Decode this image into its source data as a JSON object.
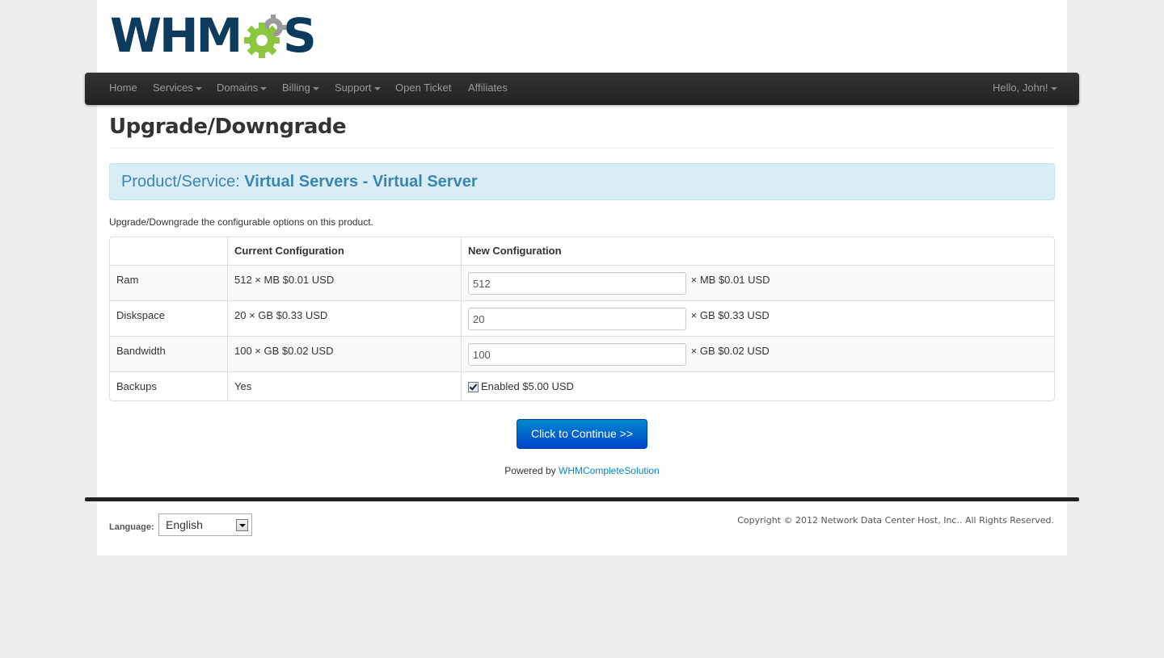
{
  "logo": {
    "text_left": "WHM",
    "text_right": "S",
    "colors": {
      "text": "#0c3b5d",
      "gear_green": "#8cc63f",
      "gear_gray": "#9a9a9a"
    }
  },
  "nav": {
    "items": [
      {
        "label": "Home",
        "dropdown": false
      },
      {
        "label": "Services",
        "dropdown": true
      },
      {
        "label": "Domains",
        "dropdown": true
      },
      {
        "label": "Billing",
        "dropdown": true
      },
      {
        "label": "Support",
        "dropdown": true
      },
      {
        "label": "Open Ticket",
        "dropdown": false
      },
      {
        "label": "Affiliates",
        "dropdown": false
      }
    ],
    "user": "Hello, John!"
  },
  "page": {
    "title": "Upgrade/Downgrade",
    "product_prefix": "Product/Service:",
    "product_name": "Virtual Servers - Virtual Server",
    "intro": "Upgrade/Downgrade the configurable options on this product."
  },
  "table": {
    "headers": [
      "",
      "Current Configuration",
      "New Configuration"
    ],
    "rows": [
      {
        "option": "Ram",
        "current": "512 × MB $0.01 USD",
        "new_value": "512",
        "new_suffix": "× MB $0.01 USD"
      },
      {
        "option": "Diskspace",
        "current": "20 × GB $0.33 USD",
        "new_value": "20",
        "new_suffix": "× GB $0.33 USD"
      },
      {
        "option": "Bandwidth",
        "current": "100 × GB $0.02 USD",
        "new_value": "100",
        "new_suffix": "× GB $0.02 USD"
      },
      {
        "option": "Backups",
        "current": "Yes",
        "checkbox_checked": true,
        "new_suffix": "Enabled $5.00 USD"
      }
    ]
  },
  "continue_button": "Click to Continue >>",
  "powered": {
    "prefix": "Powered by",
    "link": "WHMCompleteSolution"
  },
  "footer": {
    "language_label": "Language:",
    "language_value": "English",
    "copyright": "Copyright © 2012 Network Data Center Host, Inc.. All Rights Reserved."
  },
  "colors": {
    "link": "#0088cc",
    "alert_text": "#3a87ad",
    "alert_bg": "#d9edf7",
    "navbar": "#222222",
    "button": "#0055cc"
  }
}
